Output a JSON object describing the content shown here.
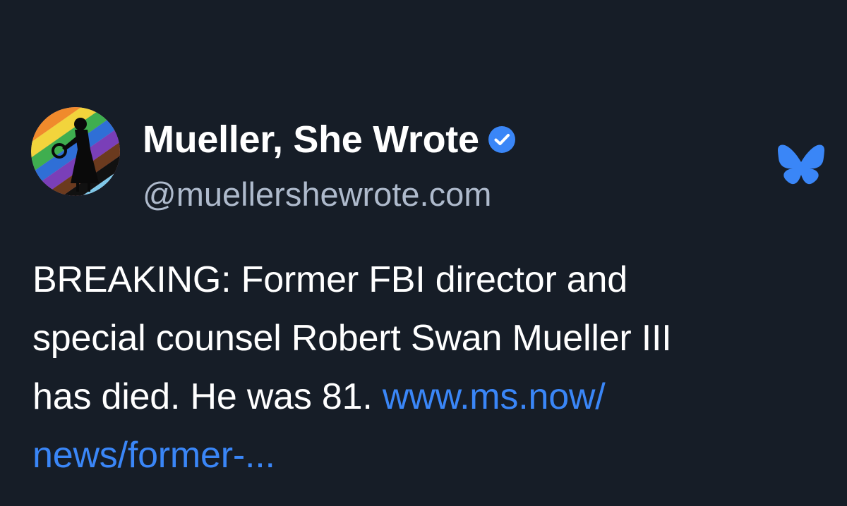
{
  "post": {
    "author": {
      "display_name": "Mueller, She Wrote",
      "handle": "@muellershewrote.com",
      "verified": true,
      "avatar_icon": "pride-flag-silhouette-avatar"
    },
    "platform_icon": "bluesky-butterfly-icon",
    "text_lines": [
      "BREAKING: Former FBI director and",
      "special counsel Robert Swan Mueller III",
      "has died. He was 81. "
    ],
    "link": {
      "line1": "www.ms.now/",
      "line2": "news/former-..."
    }
  },
  "colors": {
    "background": "#161d27",
    "text": "#ffffff",
    "handle": "#aebacc",
    "link": "#3a86f7",
    "verified": "#3a86f7",
    "bluesky": "#3a86f7"
  }
}
